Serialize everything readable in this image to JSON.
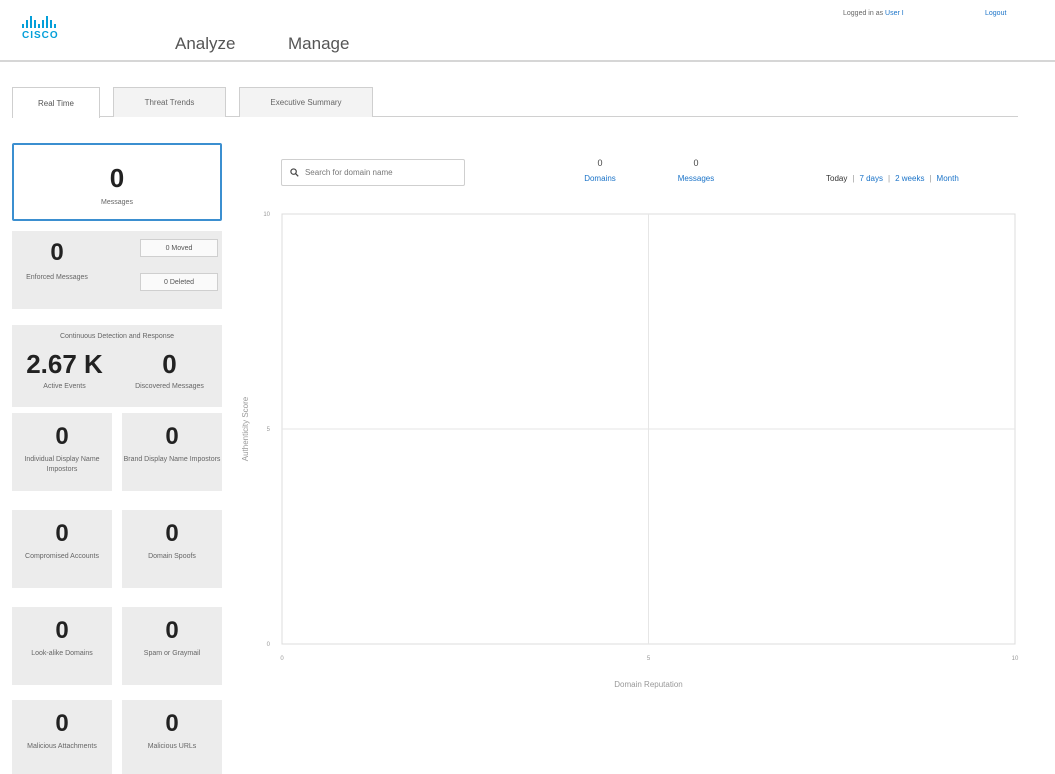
{
  "header": {
    "logo_text": "CISCO",
    "nav": [
      {
        "label": "Analyze"
      },
      {
        "label": "Manage"
      }
    ],
    "logged_in_prefix": "Logged in as",
    "user": "User I",
    "logout": "Logout"
  },
  "tabs": [
    {
      "label": "Real Time",
      "active": true
    },
    {
      "label": "Threat Trends",
      "active": false
    },
    {
      "label": "Executive Summary",
      "active": false
    }
  ],
  "tiles": {
    "messages": {
      "value": "0",
      "label": "Messages"
    },
    "enforced": {
      "value": "0",
      "label": "Enforced Messages",
      "moved": "0 Moved",
      "deleted": "0 Deleted"
    },
    "cdr": {
      "title": "Continuous Detection and Response",
      "active_value": "2.67 K",
      "active_label": "Active Events",
      "discovered_value": "0",
      "discovered_label": "Discovered Messages"
    },
    "grid": [
      {
        "value": "0",
        "label": "Individual Display Name Impostors"
      },
      {
        "value": "0",
        "label": "Brand Display Name Impostors"
      },
      {
        "value": "0",
        "label": "Compromised Accounts"
      },
      {
        "value": "0",
        "label": "Domain Spoofs"
      },
      {
        "value": "0",
        "label": "Look-alike Domains"
      },
      {
        "value": "0",
        "label": "Spam or Graymail"
      },
      {
        "value": "0",
        "label": "Malicious Attachments"
      },
      {
        "value": "0",
        "label": "Malicious URLs"
      }
    ]
  },
  "search": {
    "placeholder": "Search for domain name",
    "value": ""
  },
  "counters": {
    "domains": {
      "value": "0",
      "label": "Domains"
    },
    "messages": {
      "value": "0",
      "label": "Messages"
    }
  },
  "range": {
    "options": [
      "Today",
      "7 days",
      "2 weeks",
      "Month"
    ],
    "selected": "Today"
  },
  "colors": {
    "accent": "#1a73c8",
    "brand": "#049fd9",
    "tile_bg": "#ececec",
    "selected_border": "#3b8fd0"
  },
  "chart_data": {
    "type": "scatter",
    "xlabel": "Domain Reputation",
    "ylabel": "Authenticity Score",
    "xlim": [
      0,
      10
    ],
    "ylim": [
      0,
      10
    ],
    "x_ticks": [
      "0",
      "5",
      "10"
    ],
    "y_ticks": [
      "0",
      "5",
      "10"
    ],
    "grid": true,
    "series": []
  }
}
